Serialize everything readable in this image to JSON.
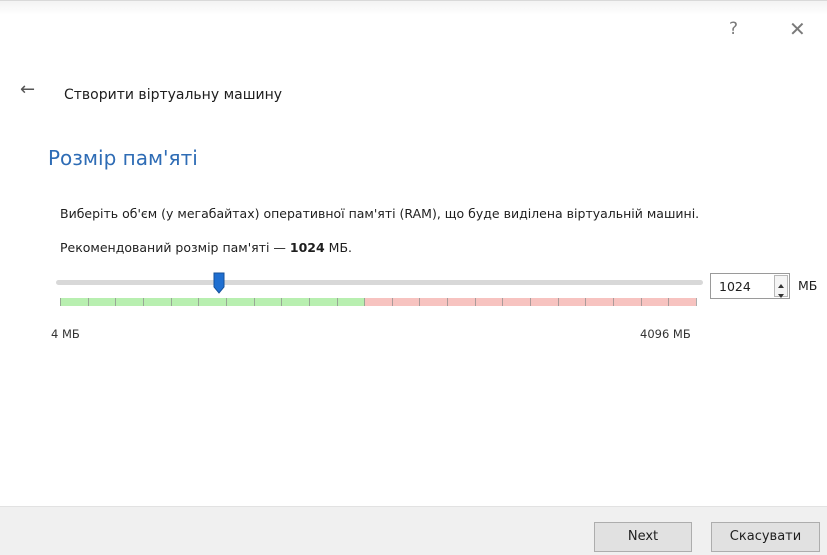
{
  "window": {
    "help_glyph": "?",
    "close_glyph": "✕"
  },
  "header": {
    "back_glyph": "←",
    "title": "Створити віртуальну машину"
  },
  "section": {
    "title": "Розмір пам'яті",
    "description": "Виберіть об'єм (у мегабайтах) оперативної пам'яті (RAM), що буде виділена віртуальній машині.",
    "recommend_prefix": "Рекомендований розмір пам'яті — ",
    "recommend_value": "1024",
    "recommend_suffix": " МБ."
  },
  "memory_slider": {
    "min_label": "4 МБ",
    "max_label": "4096 МБ",
    "min_value": 4,
    "max_value": 4096,
    "value": 1024,
    "recommended_zone_fraction": 0.48,
    "tick_count": 24,
    "colors": {
      "safe_zone": "#b8efb0",
      "warning_zone": "#f7c3c0",
      "handle": "#1f6fd1"
    }
  },
  "spinbox": {
    "value": "1024",
    "unit": "МБ",
    "up_icon": "spin-up-arrow",
    "down_icon": "spin-down-arrow"
  },
  "footer": {
    "next_label": "Next",
    "cancel_label": "Скасувати"
  },
  "colors": {
    "accent_title": "#2e6cb5",
    "footer_bg": "#f0f0f0"
  }
}
